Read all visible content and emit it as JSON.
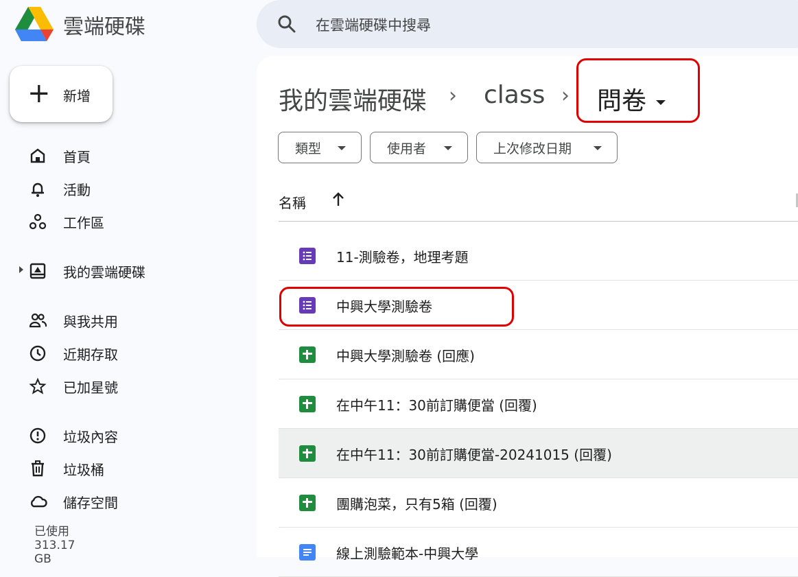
{
  "app": {
    "title": "雲端硬碟"
  },
  "search": {
    "placeholder": "在雲端硬碟中搜尋"
  },
  "new_button": {
    "label": "新增"
  },
  "sidebar": {
    "items": [
      {
        "label": "首頁",
        "icon": "home-icon"
      },
      {
        "label": "活動",
        "icon": "bell-icon"
      },
      {
        "label": "工作區",
        "icon": "workspaces-icon"
      },
      {
        "label": "我的雲端硬碟",
        "icon": "my-drive-icon"
      },
      {
        "label": "與我共用",
        "icon": "people-icon"
      },
      {
        "label": "近期存取",
        "icon": "clock-icon"
      },
      {
        "label": "已加星號",
        "icon": "star-icon"
      },
      {
        "label": "垃圾內容",
        "icon": "spam-icon"
      },
      {
        "label": "垃圾桶",
        "icon": "trash-icon"
      },
      {
        "label": "儲存空間",
        "icon": "cloud-icon"
      }
    ],
    "storage_used": "已使用 313.17 GB"
  },
  "breadcrumb": {
    "root": "我的雲端硬碟",
    "level1": "class",
    "current": "問卷"
  },
  "filters": {
    "type": "類型",
    "people": "使用者",
    "modified": "上次修改日期"
  },
  "list": {
    "column_name": "名稱",
    "files": [
      {
        "name": "11-測驗卷，地理考題",
        "kind": "form"
      },
      {
        "name": "中興大學測驗卷",
        "kind": "form"
      },
      {
        "name": "中興大學測驗卷 (回應)",
        "kind": "sheet"
      },
      {
        "name": "在中午11：30前訂購便當 (回覆)",
        "kind": "sheet"
      },
      {
        "name": "在中午11：30前訂購便當-20241015 (回覆)",
        "kind": "sheet"
      },
      {
        "name": "團購泡菜，只有5箱 (回覆)",
        "kind": "sheet"
      },
      {
        "name": "線上測驗範本-中興大學",
        "kind": "doc"
      }
    ]
  },
  "colors": {
    "accent_red": "#e00000",
    "form": "#673ab7",
    "sheet": "#1e8e3e",
    "doc": "#4285f4"
  }
}
